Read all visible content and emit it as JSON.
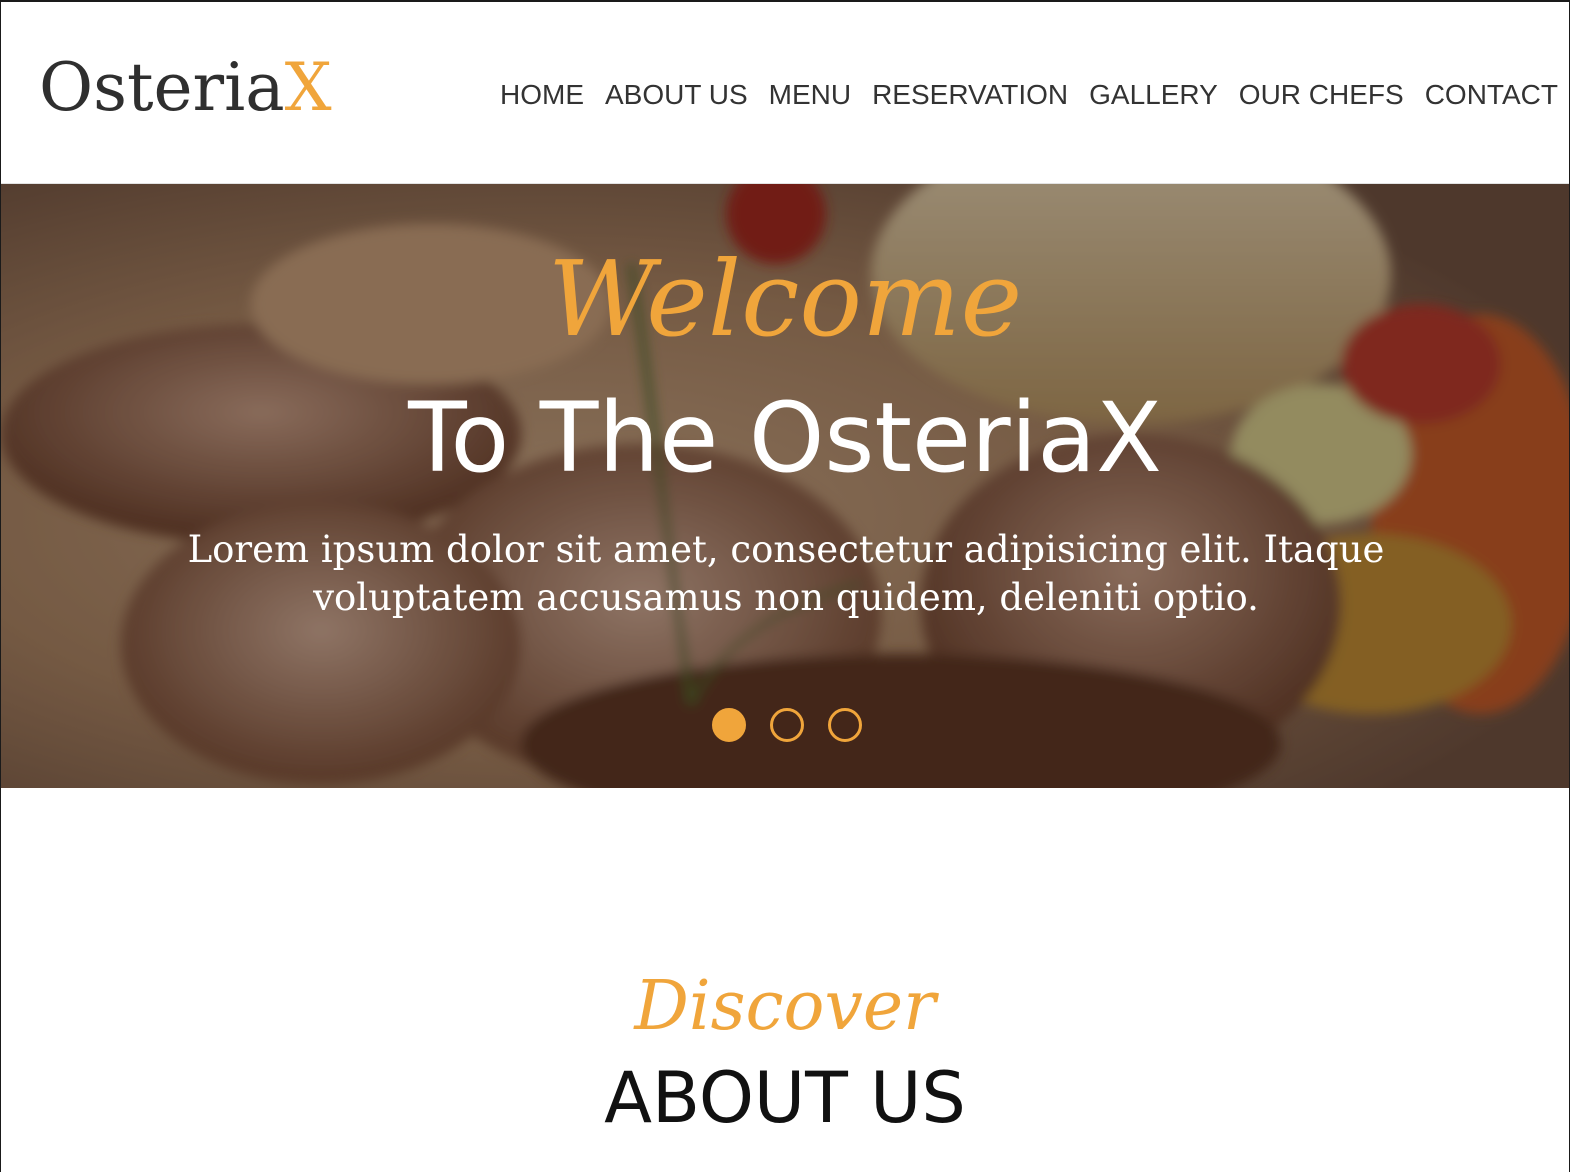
{
  "header": {
    "logo_main": "Osteria",
    "logo_accent": "X",
    "nav": [
      {
        "label": "HOME"
      },
      {
        "label": "ABOUT US"
      },
      {
        "label": "MENU"
      },
      {
        "label": "RESERVATION"
      },
      {
        "label": "GALLERY"
      },
      {
        "label": "OUR CHEFS"
      },
      {
        "label": "CONTACT"
      }
    ]
  },
  "hero": {
    "script_title": "Welcome",
    "title": "To The OsteriaX",
    "text": "Lorem ipsum dolor sit amet, consectetur adipisicing elit. Itaque voluptatem accusamus non quidem, deleniti optio.",
    "slides_count": 3,
    "active_slide": 1
  },
  "about": {
    "script_title": "Discover",
    "title": "ABOUT US"
  },
  "colors": {
    "accent": "#f0a53b",
    "text_dark": "#2f2f2f",
    "white": "#ffffff"
  }
}
